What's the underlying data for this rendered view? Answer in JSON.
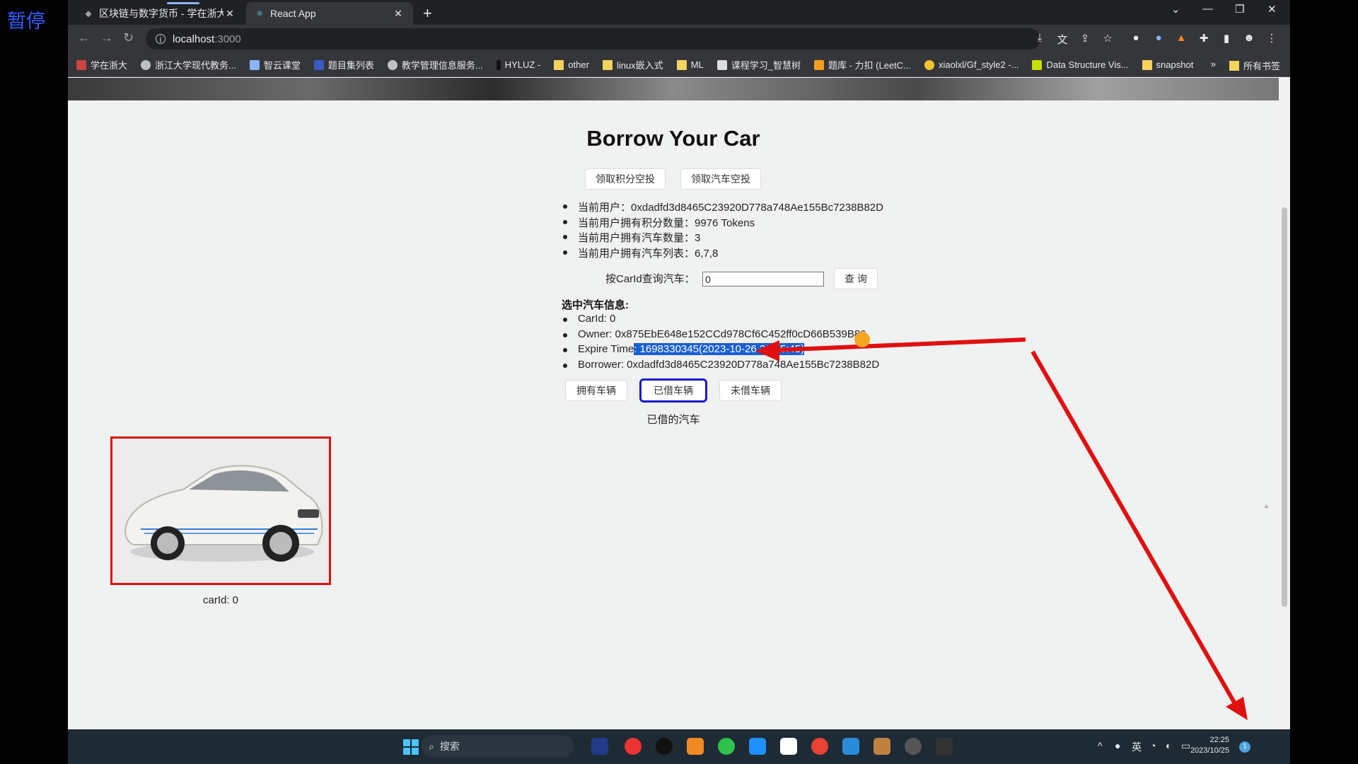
{
  "corner_label": "暂停",
  "tabs": [
    {
      "title": "区块链与数字货币 - 学在浙大",
      "active": false
    },
    {
      "title": "React App",
      "active": true
    }
  ],
  "address_bar": {
    "host": "localhost",
    "port": ":3000"
  },
  "bookmarks": [
    {
      "label": "学在浙大",
      "icon": "site-icon"
    },
    {
      "label": "浙江大学现代教务...",
      "icon": "globe-icon"
    },
    {
      "label": "智云课堂",
      "icon": "site-icon"
    },
    {
      "label": "题目集列表",
      "icon": "site-icon"
    },
    {
      "label": "教学管理信息服务...",
      "icon": "globe-icon"
    },
    {
      "label": "HYLUZ -",
      "icon": "site-icon"
    },
    {
      "label": "other",
      "icon": "folder-icon"
    },
    {
      "label": "linux嵌入式",
      "icon": "folder-icon"
    },
    {
      "label": "ML",
      "icon": "folder-icon"
    },
    {
      "label": "课程学习_智慧树",
      "icon": "site-icon"
    },
    {
      "label": "题库 - 力扣 (LeetC...",
      "icon": "site-icon"
    },
    {
      "label": "xiaolxl/Gf_style2 -...",
      "icon": "site-icon"
    },
    {
      "label": "Data Structure Vis...",
      "icon": "site-icon"
    },
    {
      "label": "snapshot",
      "icon": "folder-icon"
    }
  ],
  "bookmarks_more": "»",
  "bookmarks_all": "所有书签",
  "page": {
    "title": "Borrow Your Car",
    "airdrop_points_button": "领取积分空投",
    "airdrop_car_button": "领取汽车空投",
    "user_info": [
      "当前用户：0xdadfd3d8465C23920D778a748Ae155Bc7238B82D",
      "当前用户拥有积分数量：9976 Tokens",
      "当前用户拥有汽车数量：3",
      "当前用户拥有汽车列表：6,7,8"
    ],
    "query_label": "按CarId查询汽车：",
    "query_value": "0",
    "query_button": "查 询",
    "selected_title": "选中汽车信息:",
    "selected_car": {
      "car_id": "CarId: 0",
      "owner": "Owner: 0x875EbE648e152CCd978Cf6C452ff0cD66B539B86",
      "expire_label": "Expire Time",
      "expire_value": ": 1698330345(2023-10-26 22:25:45)",
      "borrower": "Borrower: 0xdadfd3d8465C23920D778a748Ae155Bc7238B82D"
    },
    "filter_buttons": {
      "owned": "拥有车辆",
      "borrowed": "已借车辆",
      "not_borrowed": "未借车辆"
    },
    "active_filter": "borrowed",
    "list_caption": "已借的汽车",
    "cars": [
      {
        "label": "carId: 0"
      }
    ]
  },
  "taskbar": {
    "search_placeholder": "搜索",
    "ime": "英",
    "time": "22:25",
    "date": "2023/10/25",
    "notification_count": "1"
  },
  "colors": {
    "annotation_red": "#e01010",
    "highlight_blue": "#1a5fd0",
    "active_button_border": "#1a1acc"
  }
}
